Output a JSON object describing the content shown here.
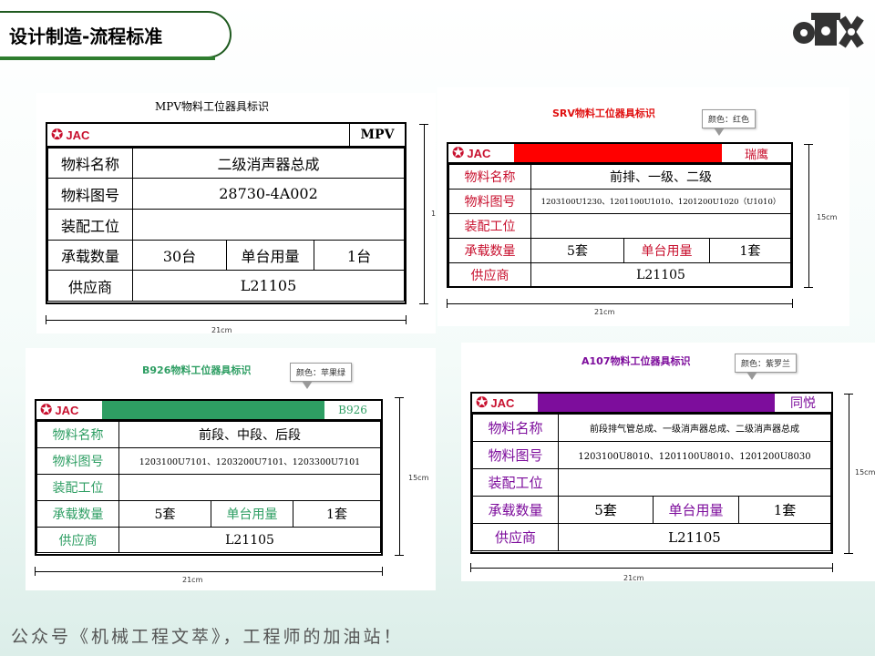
{
  "page": {
    "title": "设计制造-流程标准",
    "footer": "公众号《机械工程文萃》，工程师的加油站！"
  },
  "brand": {
    "logo_text": "JAC"
  },
  "mpv": {
    "title": "MPV物料工位器具标识",
    "code": "MPV",
    "r1_label": "物料名称",
    "r1_value": "二级消声器总成",
    "r2_label": "物料图号",
    "r2_value": "28730-4A002",
    "r3_label": "装配工位",
    "r3_value": "",
    "r4_label": "承载数量",
    "r4_value": "30台",
    "r4_label2": "单台用量",
    "r4_value2": "1台",
    "r5_label": "供应商",
    "r5_value": "L21105",
    "width": "21cm",
    "height_mark": "1"
  },
  "srv": {
    "title": "SRV物料工位器具标识",
    "tag": "颜色：红色",
    "code": "瑞鹰",
    "color": "#ff0000",
    "r1_label": "物料名称",
    "r1_value": "前排、一级、二级",
    "r2_label": "物料图号",
    "r2_value": "1203100U1230、1201100U1010、1201200U1020（U1010）",
    "r3_label": "装配工位",
    "r3_value": "",
    "r4_label": "承载数量",
    "r4_value": "5套",
    "r4_label2": "单台用量",
    "r4_value2": "1套",
    "r5_label": "供应商",
    "r5_value": "L21105",
    "width": "21cm",
    "height": "15cm"
  },
  "b926": {
    "title": "B926物料工位器具标识",
    "tag": "颜色：苹果绿",
    "code": "B926",
    "color": "#2e9e63",
    "r1_label": "物料名称",
    "r1_value": "前段、中段、后段",
    "r2_label": "物料图号",
    "r2_value": "1203100U7101、1203200U7101、1203300U7101",
    "r3_label": "装配工位",
    "r3_value": "",
    "r4_label": "承载数量",
    "r4_value": "5套",
    "r4_label2": "单台用量",
    "r4_value2": "1套",
    "r5_label": "供应商",
    "r5_value": "L21105",
    "width": "21cm",
    "height": "15cm"
  },
  "a107": {
    "title": "A107物料工位器具标识",
    "tag": "颜色：紫罗兰",
    "code": "同悦",
    "color": "#7d0d9c",
    "r1_label": "物料名称",
    "r1_value": "前段排气管总成、一级消声器总成、二级消声器总成",
    "r2_label": "物料图号",
    "r2_value": "1203100U8010、1201100U8010、1201200U8030",
    "r3_label": "装配工位",
    "r3_value": "",
    "r4_label": "承载数量",
    "r4_value": "5套",
    "r4_label2": "单台用量",
    "r4_value2": "1套",
    "r5_label": "供应商",
    "r5_value": "L21105",
    "width": "21cm",
    "height": "15cm"
  }
}
